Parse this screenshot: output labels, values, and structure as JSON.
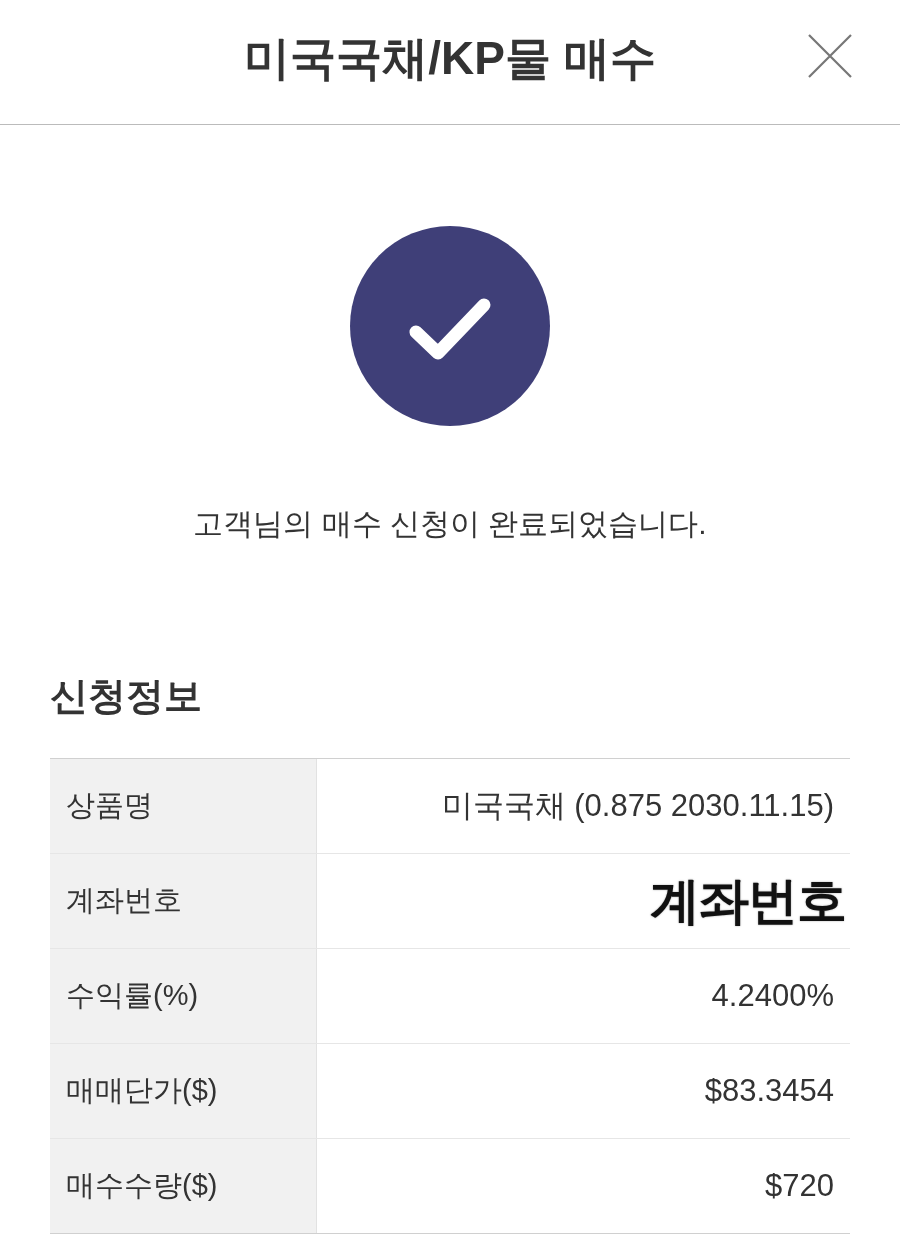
{
  "header": {
    "title": "미국국채/KP물 매수"
  },
  "result": {
    "message": "고객님의 매수 신청이 완료되었습니다."
  },
  "section": {
    "title": "신청정보"
  },
  "table": {
    "rows": [
      {
        "label": "상품명",
        "value": "미국국채 (0.875 2030.11.15)",
        "kind": "plain"
      },
      {
        "label": "계좌번호",
        "value": "계좌번호",
        "kind": "masked"
      },
      {
        "label": "수익률(%)",
        "value": "4.2400%",
        "kind": "plain"
      },
      {
        "label": "매매단가($)",
        "value": "$83.3454",
        "kind": "plain"
      },
      {
        "label": "매수수량($)",
        "value": "$720",
        "kind": "plain"
      }
    ]
  }
}
